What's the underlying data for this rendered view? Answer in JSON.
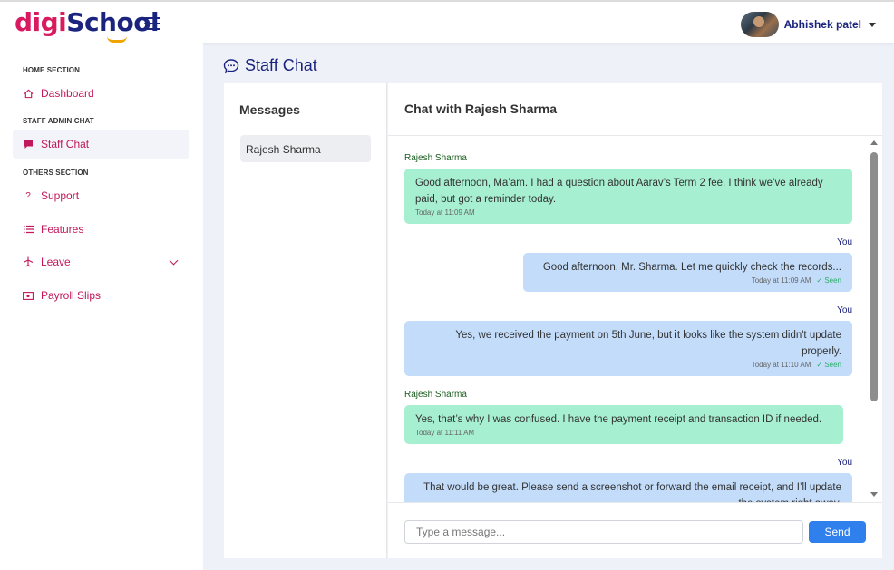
{
  "header": {
    "logo_part1": "digi",
    "logo_part2": "School",
    "user_name": "Abhishek patel"
  },
  "sidebar": {
    "sections": [
      {
        "title": "HOME SECTION"
      },
      {
        "title": "STAFF ADMIN CHAT"
      },
      {
        "title": "OTHERS SECTION"
      }
    ],
    "items": [
      {
        "label": "Dashboard",
        "icon": "home-icon"
      },
      {
        "label": "Staff Chat",
        "icon": "chat-icon",
        "active": true
      },
      {
        "label": "Support",
        "icon": "question-icon"
      },
      {
        "label": "Features",
        "icon": "list-icon"
      },
      {
        "label": "Leave",
        "icon": "plane-icon"
      },
      {
        "label": "Payroll Slips",
        "icon": "money-icon"
      }
    ]
  },
  "page": {
    "title": "Staff Chat"
  },
  "messages_panel": {
    "heading": "Messages",
    "contacts": [
      {
        "name": "Rajesh Sharma"
      }
    ]
  },
  "chat": {
    "heading": "Chat with Rajesh Sharma",
    "you_label": "You",
    "seen_label": "✓ Seen",
    "messages": [
      {
        "from": "Rajesh Sharma",
        "text": "Good afternoon, Ma’am. I had a question about Aarav’s Term 2 fee. I think we’ve already paid, but got a reminder today.",
        "time": "Today at 11:09 AM"
      },
      {
        "from": "You",
        "text": "Good afternoon, Mr. Sharma. Let me quickly check the records...",
        "time": "Today at 11:09 AM",
        "seen": true
      },
      {
        "from": "You",
        "text": "Yes, we received the payment on 5th June, but it looks like the system didn't update properly.",
        "time": "Today at 11:10 AM",
        "seen": true
      },
      {
        "from": "Rajesh Sharma",
        "text": "Yes, that’s why I was confused. I have the payment receipt and transaction ID if needed.",
        "time": "Today at 11:11 AM"
      },
      {
        "from": "You",
        "text": "That would be great. Please send a screenshot or forward the email receipt, and I’ll update the system right away."
      }
    ],
    "input_placeholder": "Type a message...",
    "send_label": "Send"
  },
  "colors": {
    "brand_pink": "#d81b60",
    "brand_navy": "#1a237e",
    "incoming_bubble": "#a7efd1",
    "outgoing_bubble": "#c2dcfa",
    "send_button": "#2f80ed"
  }
}
